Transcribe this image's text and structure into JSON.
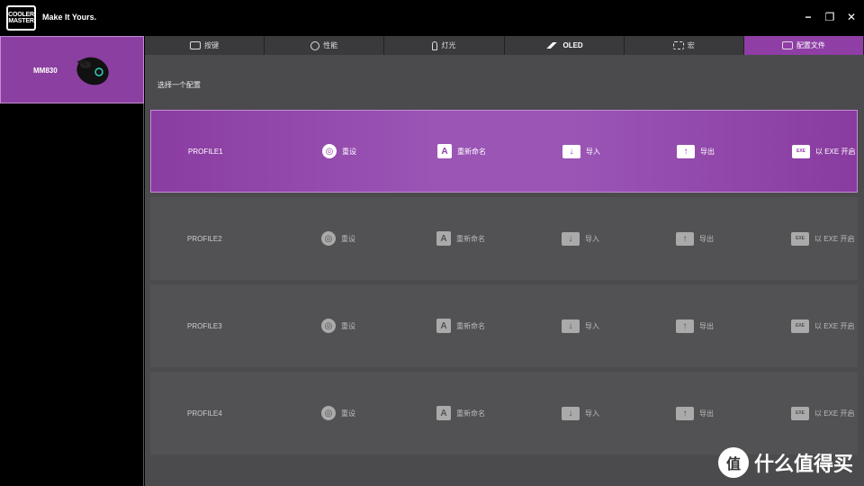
{
  "header": {
    "logo_line1": "COOLER",
    "logo_line2": "MASTER",
    "tagline": "Make It Yours.",
    "window_controls": [
      "−",
      "❐",
      "✕"
    ]
  },
  "sidebar": {
    "device_name": "MM830",
    "accent_color": "#8b3fa0"
  },
  "tabs": [
    {
      "label": "按键",
      "icon": "keyboard-icon"
    },
    {
      "label": "性能",
      "icon": "gauge-icon"
    },
    {
      "label": "灯光",
      "icon": "bulb-icon"
    },
    {
      "label": "OLED",
      "icon": "oled-icon"
    },
    {
      "label": "宏",
      "icon": "macro-icon"
    },
    {
      "label": "配置文件",
      "icon": "profile-icon",
      "active": true
    }
  ],
  "subtitle": "选择一个配置",
  "profiles": [
    {
      "name": "PROFILE1",
      "selected": true
    },
    {
      "name": "PROFILE2",
      "selected": false
    },
    {
      "name": "PROFILE3",
      "selected": false
    },
    {
      "name": "PROFILE4",
      "selected": false
    }
  ],
  "actions": {
    "reset": "重设",
    "rename": "重新命名",
    "import": "导入",
    "export": "导出",
    "exe": "以 EXE 开启"
  },
  "icons": {
    "rename_glyph": "A",
    "exe_glyph": "EXE"
  },
  "watermark": {
    "circle": "值",
    "text": "什么值得买"
  }
}
